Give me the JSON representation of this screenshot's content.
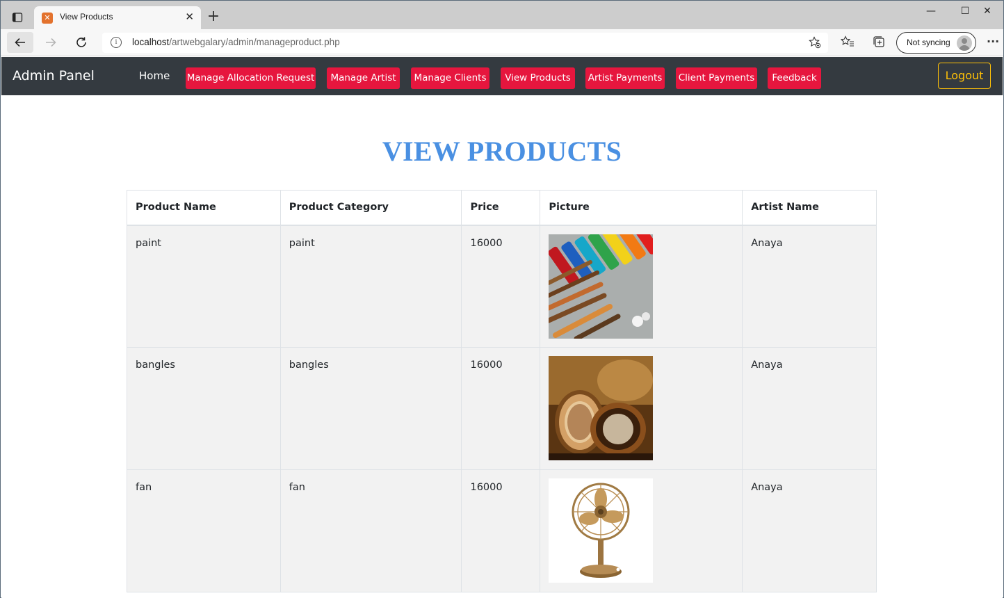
{
  "browser": {
    "tab_title": "View Products",
    "url_host": "localhost",
    "url_path": "/artwebgalary/admin/manageproduct.php",
    "sync_label": "Not syncing"
  },
  "navbar": {
    "brand": "Admin Panel",
    "home": "Home",
    "menu": [
      {
        "label": "Manage Allocation Request"
      },
      {
        "label": "Manage Artist"
      },
      {
        "label": "Manage Clients"
      },
      {
        "label": "View Products"
      },
      {
        "label": "Artist Payments"
      },
      {
        "label": "Client Payments"
      },
      {
        "label": "Feedback"
      }
    ],
    "logout": "Logout",
    "menu_color": "#e6163e",
    "bar_color": "#343a40",
    "logout_color": "#ffc107"
  },
  "page": {
    "title": "VIEW PRODUCTS",
    "title_color": "#4a90e2"
  },
  "table": {
    "headers": [
      "Product Name",
      "Product Category",
      "Price",
      "Picture",
      "Artist Name"
    ],
    "rows": [
      {
        "name": "paint",
        "category": "paint",
        "price": "16000",
        "picture": "paint-tubes-and-brushes-image",
        "artist": "Anaya"
      },
      {
        "name": "bangles",
        "category": "bangles",
        "price": "16000",
        "picture": "bangles-image",
        "artist": "Anaya"
      },
      {
        "name": "fan",
        "category": "fan",
        "price": "16000",
        "picture": "brass-fan-image",
        "artist": "Anaya"
      }
    ]
  }
}
